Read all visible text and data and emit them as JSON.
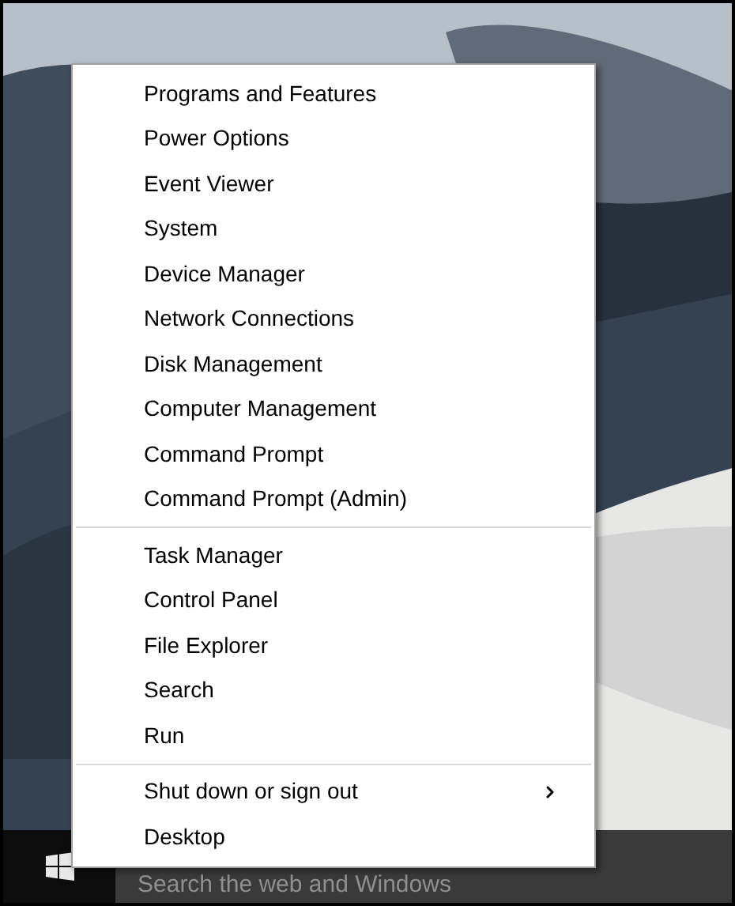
{
  "menu": {
    "sections": [
      {
        "items": [
          {
            "label": "Programs and Features",
            "has_submenu": false
          },
          {
            "label": "Power Options",
            "has_submenu": false
          },
          {
            "label": "Event Viewer",
            "has_submenu": false
          },
          {
            "label": "System",
            "has_submenu": false
          },
          {
            "label": "Device Manager",
            "has_submenu": false
          },
          {
            "label": "Network Connections",
            "has_submenu": false
          },
          {
            "label": "Disk Management",
            "has_submenu": false
          },
          {
            "label": "Computer Management",
            "has_submenu": false
          },
          {
            "label": "Command Prompt",
            "has_submenu": false
          },
          {
            "label": "Command Prompt (Admin)",
            "has_submenu": false
          }
        ]
      },
      {
        "items": [
          {
            "label": "Task Manager",
            "has_submenu": false
          },
          {
            "label": "Control Panel",
            "has_submenu": false
          },
          {
            "label": "File Explorer",
            "has_submenu": false
          },
          {
            "label": "Search",
            "has_submenu": false
          },
          {
            "label": "Run",
            "has_submenu": false
          }
        ]
      },
      {
        "items": [
          {
            "label": "Shut down or sign out",
            "has_submenu": true
          },
          {
            "label": "Desktop",
            "has_submenu": false
          }
        ]
      }
    ]
  },
  "taskbar": {
    "search": {
      "placeholder": "Search the web and Windows"
    }
  }
}
